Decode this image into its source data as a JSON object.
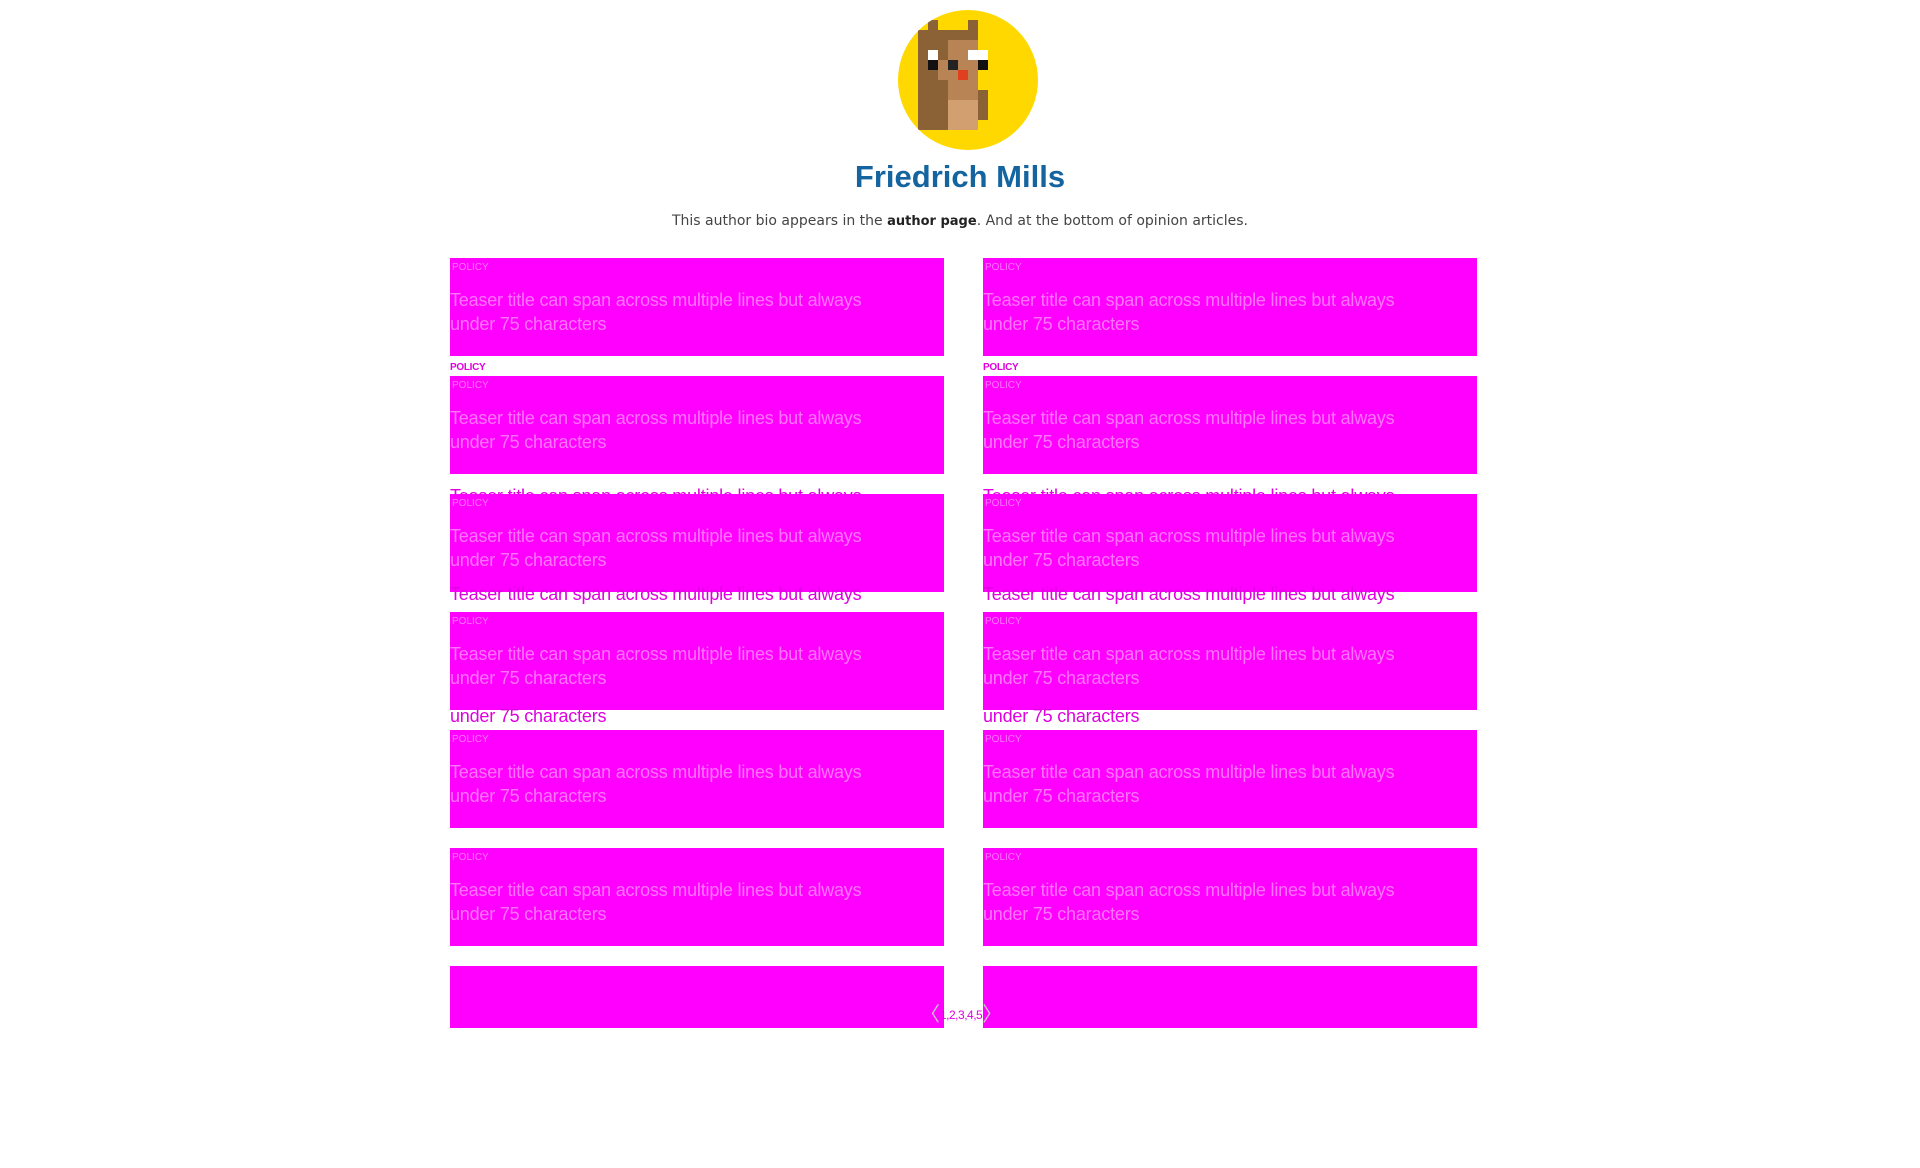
{
  "author": {
    "name": "Friedrich Mills",
    "bio_before": "This author bio appears in the ",
    "bio_bold": "author page",
    "bio_after": ". And at the bottom of opinion articles.",
    "avatar_icon": "pixel-bear-avatar",
    "avatar_bg": "#ffd800"
  },
  "colors": {
    "name": "#1464a0",
    "placeholder": "#ff00ff"
  },
  "teasers": {
    "category": "POLICY",
    "title": "Teaser title can span across multiple lines but always under 75 characters",
    "title_line1": "Teaser title can span across multiple lines but always",
    "title_line2": "under 75 characters"
  },
  "pagination": {
    "prev_icon": "chevron-left-icon",
    "next_icon": "chevron-right-icon",
    "prev": "〈",
    "next": "〉",
    "pages": "1,2,3,4,5"
  }
}
